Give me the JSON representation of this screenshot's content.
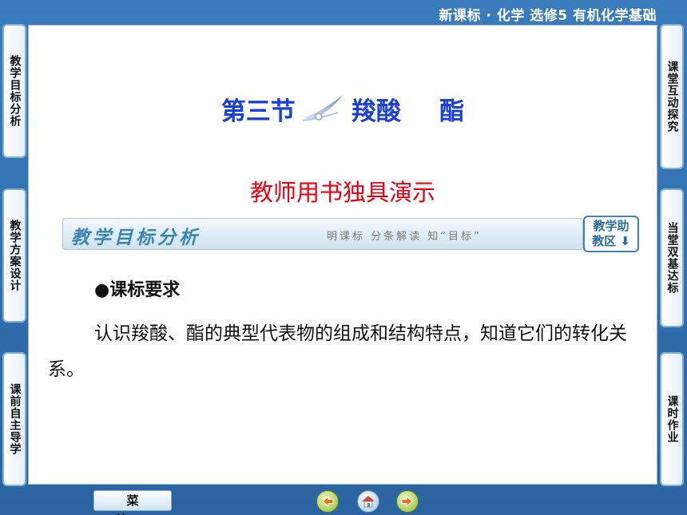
{
  "header": {
    "title": "新课标 · 化学  选修5  有机化学基础"
  },
  "left_nav": [
    {
      "label": "教学目标分析"
    },
    {
      "label": "教学方案设计"
    },
    {
      "label": "课前自主导学"
    }
  ],
  "right_nav": [
    {
      "label": "课堂互动探究"
    },
    {
      "label": "当堂双基达标"
    },
    {
      "label": "课时作业"
    }
  ],
  "content": {
    "section_title_part1": "第三节",
    "section_title_part2": "羧酸",
    "section_title_part3": "酯",
    "subtitle": "教师用书独具演示",
    "banner": {
      "title": "教学目标分析",
      "slogan": "明课标  分条解读  知“目标”",
      "assist_line1": "教学助",
      "assist_line2": "教区 ⬇"
    },
    "heading": "●课标要求",
    "body": "认识羧酸、酯的典型代表物的组成和结构特点，知道它们的转化关系。"
  },
  "bottom_bar": {
    "menu_label": "菜单",
    "buttons": [
      {
        "icon": "back-arrow-icon"
      },
      {
        "icon": "home-icon"
      },
      {
        "icon": "forward-arrow-icon"
      }
    ]
  },
  "colors": {
    "background": "#2f6ea8",
    "title_blue": "#1a3fd6",
    "subtitle_red": "#e60012",
    "accent": "#3a85b3"
  }
}
